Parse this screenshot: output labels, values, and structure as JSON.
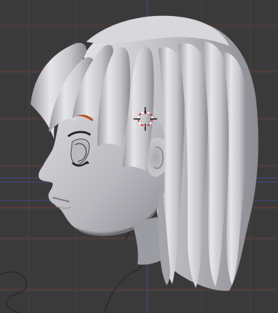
{
  "viewport": {
    "view": "3d-viewport",
    "background_color": "#3a3a3a",
    "grid_line_color": "#444444",
    "floor_line_red": "#8a3b3b",
    "floor_line_blue": "#4b4b8a",
    "model_color": "#c8c8cc",
    "model_shadow_color": "#7d7d84",
    "eyebrow_color": "#b8521e",
    "eye_outline_color": "#222222",
    "cursor_color": "#d63b3b",
    "icons": [
      "3d-cursor-icon"
    ]
  }
}
